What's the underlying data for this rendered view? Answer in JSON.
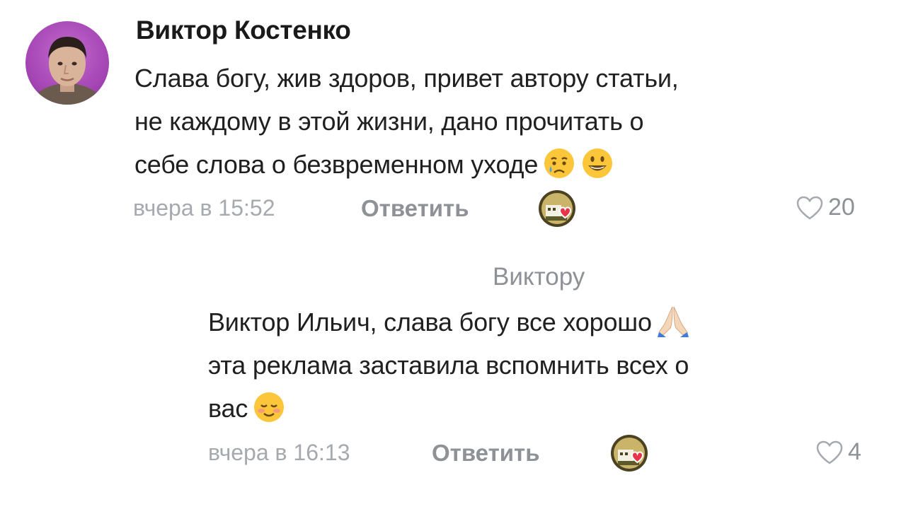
{
  "comments": [
    {
      "author": "Виктор Костенко",
      "lines": [
        "Слава богу, жив здоров, привет автору статьи,",
        "не каждому в этой жизни, дано прочитать о",
        "себе слова о безвременном уходе"
      ],
      "emojis": [
        "crying-face",
        "smiling-face"
      ],
      "time": "вчера в 15:52",
      "reply_label": "Ответить",
      "likes": "20"
    },
    {
      "reply_to": "Виктору",
      "lines": [
        "Виктор Ильич, слава богу все хорошо",
        "эта реклама заставила вспомнить всех о",
        "вас"
      ],
      "emojis": [
        "praying-hands",
        "blushing-face"
      ],
      "time": "вчера в 16:13",
      "reply_label": "Ответить",
      "likes": "4"
    }
  ],
  "colors": {
    "meta_text": "#a6a9ae",
    "action_text": "#8e9196",
    "heart_red": "#e8334a",
    "avatar_bg": "#a041b0"
  }
}
